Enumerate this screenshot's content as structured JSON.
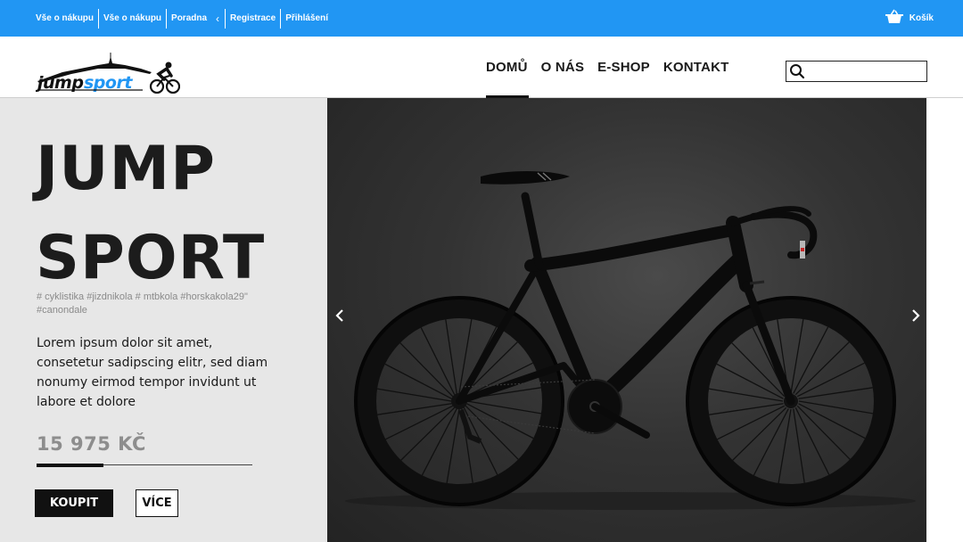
{
  "topbar": {
    "links": [
      "Vše o nákupu",
      "Vše o nákupu",
      "Poradna",
      "Registrace",
      "Přihlášení"
    ],
    "cart_label": "Košík"
  },
  "header": {
    "logo_text": "jumpsport",
    "nav": [
      "DOMŮ",
      "O NÁS",
      "E-SHOP",
      "KONTAKT"
    ],
    "active_nav": "DOMŮ",
    "search_placeholder": ""
  },
  "hero": {
    "title_line1": "JUMP",
    "title_line2": "SPORT",
    "tags": "# cyklistika #jizdnikola # mtbkola #horskakola29\" #canondale",
    "description": "Lorem ipsum dolor sit amet, consetetur sadipscing elitr, sed diam nonumy eirmod tempor invidunt ut labore et dolore",
    "price": "15 975 KČ",
    "progress": 0.31,
    "buy_label": "KOUPIT",
    "more_label": "VÍCE"
  },
  "colors": {
    "accent": "#2196f3",
    "panel": "#e7e7e7",
    "dark": "#111111"
  }
}
